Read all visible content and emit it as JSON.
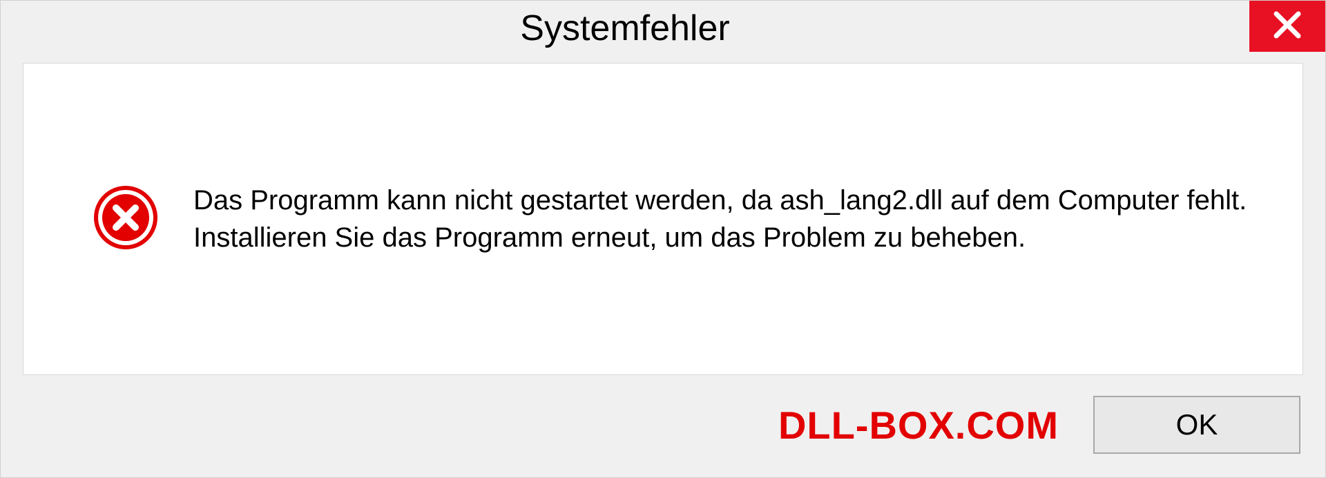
{
  "dialog": {
    "title": "Systemfehler",
    "message": "Das Programm kann nicht gestartet werden, da ash_lang2.dll auf dem Computer fehlt. Installieren Sie das Programm erneut, um das Problem zu beheben.",
    "ok_label": "OK",
    "watermark": "DLL-BOX.COM"
  }
}
